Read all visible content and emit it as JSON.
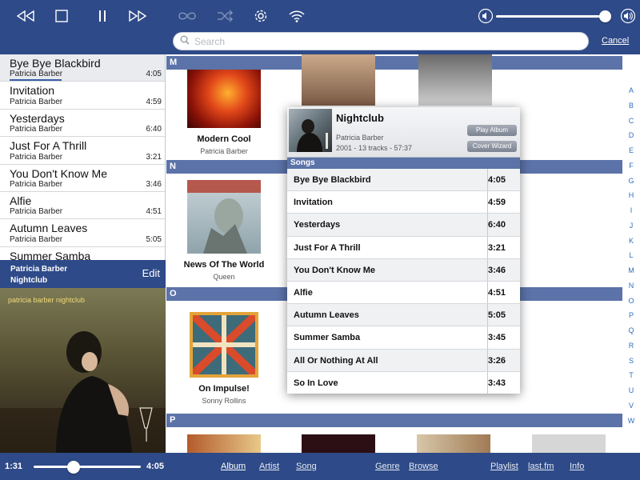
{
  "toolbar": {
    "icons": [
      "rewind-icon",
      "stop-icon",
      "pause-icon",
      "fast-forward-icon",
      "repeat-icon",
      "shuffle-icon",
      "gear-icon",
      "wifi-icon",
      "volume-low-icon",
      "volume-high-icon"
    ],
    "volume_level": 1.0
  },
  "search": {
    "placeholder": "Search",
    "cancel_label": "Cancel"
  },
  "queue": {
    "items": [
      {
        "title": "Bye Bye Blackbird",
        "artist": "Patricia Barber",
        "duration": "4:05"
      },
      {
        "title": "Invitation",
        "artist": "Patricia Barber",
        "duration": "4:59"
      },
      {
        "title": "Yesterdays",
        "artist": "Patricia Barber",
        "duration": "6:40"
      },
      {
        "title": "Just For A Thrill",
        "artist": "Patricia Barber",
        "duration": "3:21"
      },
      {
        "title": "You Don't Know Me",
        "artist": "Patricia Barber",
        "duration": "3:46"
      },
      {
        "title": "Alfie",
        "artist": "Patricia Barber",
        "duration": "4:51"
      },
      {
        "title": "Autumn Leaves",
        "artist": "Patricia Barber",
        "duration": "5:05"
      },
      {
        "title": "Summer Samba",
        "artist": "",
        "duration": ""
      }
    ]
  },
  "now_playing": {
    "artist": "Patricia Barber",
    "album": "Nightclub",
    "edit_label": "Edit",
    "art_text": "patricia barber nightclub"
  },
  "playback": {
    "elapsed": "1:31",
    "total": "4:05",
    "progress": 0.37
  },
  "nav": {
    "album": "Album",
    "artist": "Artist",
    "song": "Song",
    "genre": "Genre",
    "browse": "Browse",
    "playlist": "Playlist",
    "lastfm": "last.fm",
    "info": "Info"
  },
  "grid": {
    "sections": {
      "m": "M",
      "n": "N",
      "o": "O",
      "p": "P"
    },
    "albums": [
      {
        "title": "Modern Cool",
        "artist": "Patricia Barber"
      },
      {
        "title": "News Of The World",
        "artist": "Queen"
      },
      {
        "title": "On Impulse!",
        "artist": "Sonny Rollins"
      }
    ]
  },
  "alphabet": [
    "A",
    "B",
    "C",
    "D",
    "E",
    "F",
    "G",
    "H",
    "I",
    "J",
    "K",
    "L",
    "M",
    "N",
    "O",
    "P",
    "Q",
    "R",
    "S",
    "T",
    "U",
    "V",
    "W"
  ],
  "popup": {
    "title": "Nightclub",
    "artist": "Patricia Barber",
    "meta": "2001  -  13 tracks  -  57:37",
    "play_album_label": "Play Album",
    "cover_wizard_label": "Cover Wizard",
    "songs_heading": "Songs",
    "songs": [
      {
        "title": "Bye Bye Blackbird",
        "duration": "4:05"
      },
      {
        "title": "Invitation",
        "duration": "4:59"
      },
      {
        "title": "Yesterdays",
        "duration": "6:40"
      },
      {
        "title": "Just For A Thrill",
        "duration": "3:21"
      },
      {
        "title": "You Don't Know Me",
        "duration": "3:46"
      },
      {
        "title": "Alfie",
        "duration": "4:51"
      },
      {
        "title": "Autumn Leaves",
        "duration": "5:05"
      },
      {
        "title": "Summer Samba",
        "duration": "3:45"
      },
      {
        "title": "All Or Nothing At All",
        "duration": "3:26"
      },
      {
        "title": "So In Love",
        "duration": "3:43"
      }
    ]
  }
}
